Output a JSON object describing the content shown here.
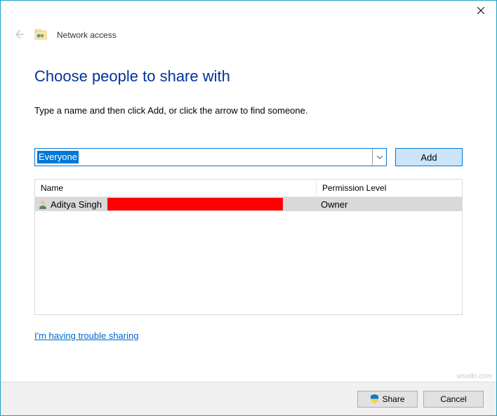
{
  "titlebar": {
    "close_tooltip": "Close"
  },
  "header": {
    "back_tooltip": "Back",
    "title": "Network access"
  },
  "main": {
    "heading": "Choose people to share with",
    "subtext": "Type a name and then click Add, or click the arrow to find someone.",
    "combo_value": "Everyone",
    "add_label": "Add"
  },
  "table": {
    "columns": {
      "name": "Name",
      "permission": "Permission Level"
    },
    "rows": [
      {
        "name": "Aditya Singh",
        "permission": "Owner"
      }
    ]
  },
  "help_link": "I'm having trouble sharing",
  "footer": {
    "share_label": "Share",
    "cancel_label": "Cancel"
  },
  "watermark": "wsxdn.com"
}
